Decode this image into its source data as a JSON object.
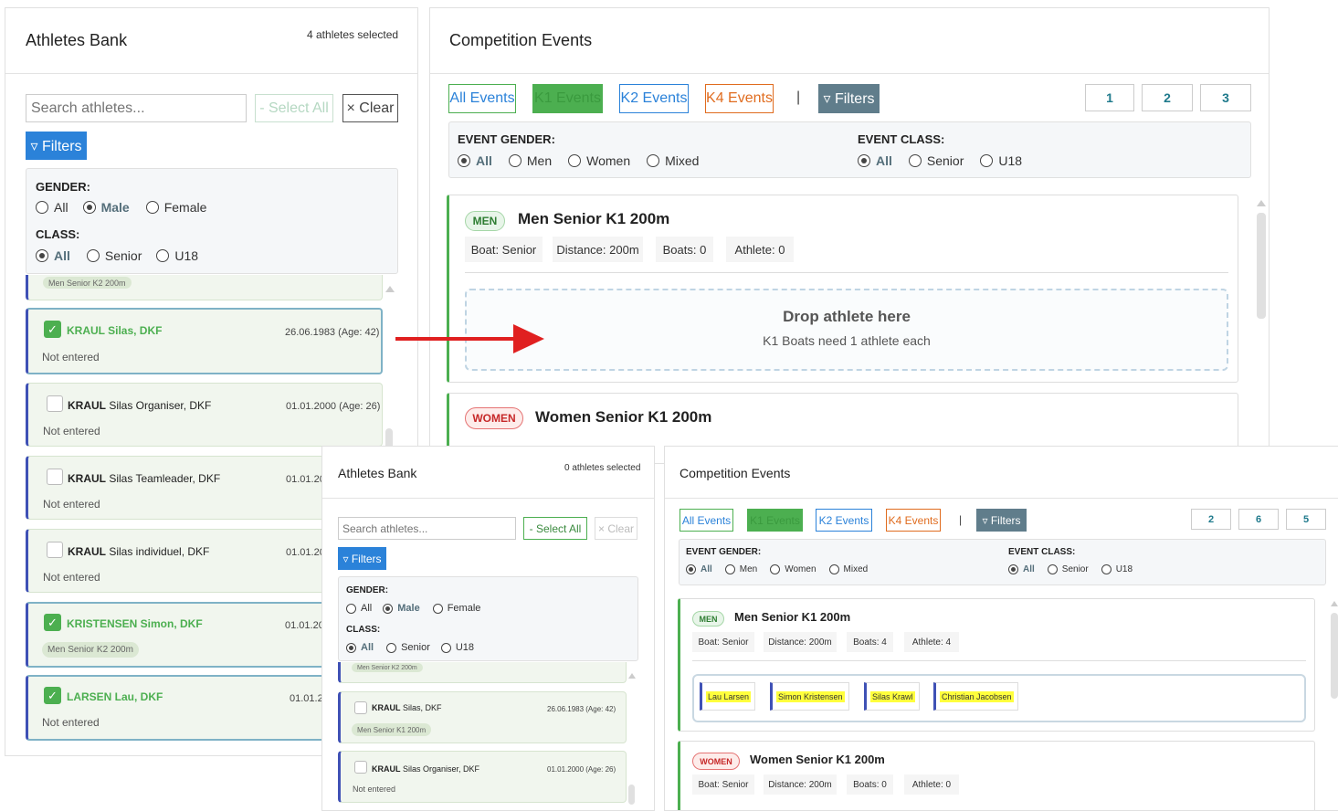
{
  "colors": {
    "green": "#4caf50",
    "blue": "#3f51b5",
    "orange": "#e06c1f",
    "filters": "#607d8b",
    "arrow": "#e02020",
    "highlight": "#ffff3d"
  },
  "ui1": {
    "athletes": {
      "title": "Athletes Bank",
      "selected": "4 athletes selected",
      "search_placeholder": "Search athletes...",
      "select_all": "- Select All",
      "clear": "× Clear",
      "filters": "▿ Filters",
      "gender_label": "GENDER:",
      "gender_opts": [
        "All",
        "Male",
        "Female"
      ],
      "class_label": "CLASS:",
      "class_opts": [
        "All",
        "Senior",
        "U18"
      ],
      "partial_pill": "Men Senior K2 200m",
      "cards": [
        {
          "name_bold": "KRAUL Silas, DKF",
          "name_rest": "",
          "date": "26.06.1983 (Age: 42)",
          "status": "Not entered",
          "checked": true
        },
        {
          "name_bold": "KRAUL",
          "name_rest": " Silas Organiser, DKF",
          "date": "01.01.2000 (Age: 26)",
          "status": "Not entered",
          "checked": false
        },
        {
          "name_bold": "KRAUL",
          "name_rest": " Silas Teamleader, DKF",
          "date": "01.01.20",
          "status": "Not entered",
          "checked": false
        },
        {
          "name_bold": "KRAUL",
          "name_rest": " Silas individuel, DKF",
          "date": "01.01.20",
          "status": "Not entered",
          "checked": false
        },
        {
          "name_bold": "KRISTENSEN Simon, DKF",
          "name_rest": "",
          "date": "01.01.20",
          "pill": "Men Senior K2 200m",
          "checked": true
        },
        {
          "name_bold": "LARSEN Lau, DKF",
          "name_rest": "",
          "date": "01.01.2",
          "status": "Not entered",
          "checked": true
        }
      ]
    },
    "events": {
      "title": "Competition Events",
      "tabs": [
        "All Events",
        "K1 Events",
        "K2 Events",
        "K4 Events"
      ],
      "sep": "|",
      "filters": "▿ Filters",
      "pages": [
        "1",
        "2",
        "3"
      ],
      "gender_label": "EVENT GENDER:",
      "gender_opts": [
        "All",
        "Men",
        "Women",
        "Mixed"
      ],
      "class_label": "EVENT CLASS:",
      "class_opts": [
        "All",
        "Senior",
        "U18"
      ],
      "card1": {
        "badge": "MEN",
        "title": "Men Senior K1 200m",
        "meta": [
          "Boat: Senior",
          "Distance: 200m",
          "Boats: 0",
          "Athlete: 0"
        ],
        "drop_title": "Drop athlete here",
        "drop_sub": "K1 Boats need 1 athlete each"
      },
      "card2": {
        "badge": "WOMEN",
        "title": "Women Senior K1 200m"
      }
    }
  },
  "ui2": {
    "athletes": {
      "title": "Athletes Bank",
      "selected": "0 athletes selected",
      "search_placeholder": "Search athletes...",
      "select_all": "- Select All",
      "clear": "× Clear",
      "filters": "▿ Filters",
      "gender_label": "GENDER:",
      "gender_opts": [
        "All",
        "Male",
        "Female"
      ],
      "class_label": "CLASS:",
      "class_opts": [
        "All",
        "Senior",
        "U18"
      ],
      "partial_pill": "Men Senior K2 200m",
      "cards": [
        {
          "name_bold": "KRAUL",
          "name_rest": " Silas, DKF",
          "date": "26.06.1983 (Age: 42)",
          "pill": "Men Senior K1 200m",
          "checked": false
        },
        {
          "name_bold": "KRAUL",
          "name_rest": " Silas Organiser, DKF",
          "date": "01.01.2000 (Age: 26)",
          "status": "Not entered",
          "checked": false
        }
      ]
    },
    "events": {
      "title": "Competition Events",
      "tabs": [
        "All Events",
        "K1 Events",
        "K2 Events",
        "K4 Events"
      ],
      "sep": "|",
      "filters": "▿ Filters",
      "pages": [
        "2",
        "6",
        "5"
      ],
      "gender_label": "EVENT GENDER:",
      "gender_opts": [
        "All",
        "Men",
        "Women",
        "Mixed"
      ],
      "class_label": "EVENT CLASS:",
      "class_opts": [
        "All",
        "Senior",
        "U18"
      ],
      "card1": {
        "badge": "MEN",
        "title": "Men Senior K1 200m",
        "meta": [
          "Boat: Senior",
          "Distance: 200m",
          "Boats: 4",
          "Athlete: 4"
        ],
        "chips": [
          "Lau Larsen",
          "Simon Kristensen",
          "Silas Krawl",
          "Christian Jacobsen"
        ]
      },
      "card2": {
        "badge": "WOMEN",
        "title": "Women Senior K1 200m",
        "meta": [
          "Boat: Senior",
          "Distance: 200m",
          "Boats: 0",
          "Athlete: 0"
        ]
      }
    }
  }
}
